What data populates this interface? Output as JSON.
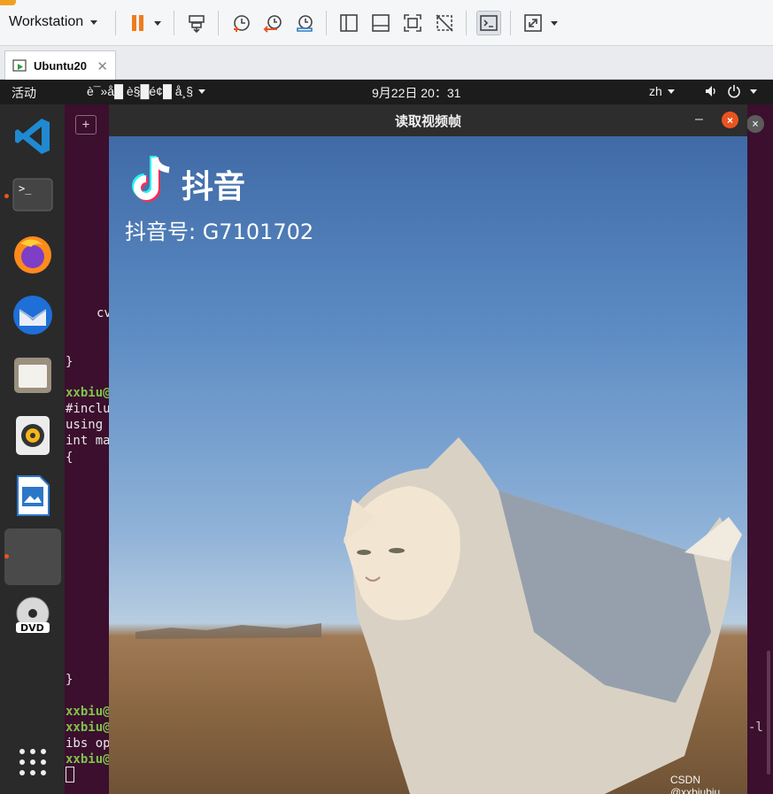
{
  "vmware": {
    "menu_label": "Workstation",
    "tab_label": "Ubuntu20",
    "tab_close": "✕"
  },
  "gnome": {
    "activities": "活动",
    "app_menu": "è¯»å█ è§█é¢█ å¸§",
    "clock": "9月22日  20：31",
    "language": "zh"
  },
  "terminal": {
    "new_tab_glyph": "+",
    "close_glyph": "×",
    "lines": [
      "cv",
      "}",
      "xxbiu@",
      "#inclu",
      "using",
      "int ma",
      "{",
      "}",
      "xxbiu@",
      "xxbiu@",
      "ibs op",
      "xxbiu@"
    ],
    "right_fragment": "-l"
  },
  "cv_window": {
    "title": "读取视频帧",
    "minimize": "–",
    "close": "×",
    "brand": "抖音",
    "account_id": "抖音号: G7101702"
  },
  "watermark": "CSDN @xxbiubiu",
  "colors": {
    "ubuntu_orange": "#e95420",
    "terminal_bg": "#3b0f2d",
    "prompt_green": "#7ec34b",
    "pause_orange": "#f07c1d"
  }
}
